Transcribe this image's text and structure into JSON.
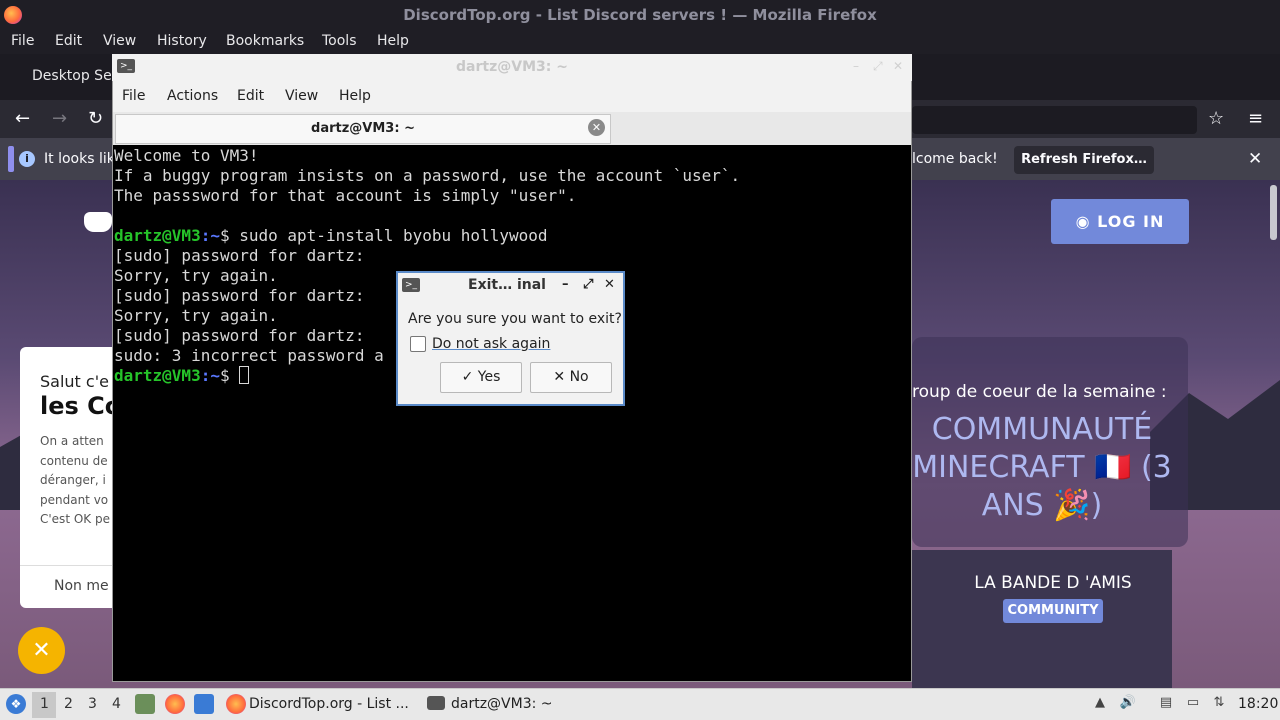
{
  "firefox": {
    "window_title": "DiscordTop.org - List Discord servers ! — Mozilla Firefox",
    "menu": [
      "File",
      "Edit",
      "View",
      "History",
      "Bookmarks",
      "Tools",
      "Help"
    ],
    "tab_label": "Desktop Ser",
    "notice_left": "It looks lik",
    "notice_right": "lcome back!",
    "refresh_label": "Refresh Firefox…",
    "close_glyph": "✕"
  },
  "page": {
    "login_label": "LOG IN",
    "cookie": {
      "greeting": "Salut c'e",
      "title": "les Co",
      "lines": [
        "On a atten",
        "contenu de",
        "déranger, i",
        "pendant vo",
        "C'est OK pe"
      ],
      "decline": "Non me"
    },
    "close_bubble": "✕",
    "feature": {
      "subtitle": "roup de coeur de la semaine :",
      "title_lines": [
        "COMMUNAUTÉ",
        "MINECRAFT 🇫🇷 (3",
        "ANS 🎉)"
      ]
    },
    "server": {
      "name": "LA BANDE D 'AMIS",
      "badge": "COMMUNITY"
    }
  },
  "terminal": {
    "window_title": "dartz@VM3: ~",
    "menu": [
      "File",
      "Actions",
      "Edit",
      "View",
      "Help"
    ],
    "tab_title": "dartz@VM3: ~",
    "lines": [
      "Welcome to VM3!",
      "If a buggy program insists on a password, use the account `user`.",
      "The passsword for that account is simply \"user\".",
      "",
      "",
      "[sudo] password for dartz:",
      "Sorry, try again.",
      "[sudo] password for dartz:",
      "Sorry, try again.",
      "[sudo] password for dartz:",
      "sudo: 3 incorrect password a"
    ],
    "prompt_user": "dartz@VM3",
    "prompt_path": ":~",
    "prompt_symbol": "$",
    "command": " sudo apt-install byobu hollywood"
  },
  "dialog": {
    "title": "Exit…  inal",
    "question": "Are you sure you want to exit?",
    "checkbox_label": "Do not ask again",
    "checkbox_checked": false,
    "yes_label": "✓ Yes",
    "no_label": "✕ No"
  },
  "taskbar": {
    "workspaces": [
      "1",
      "2",
      "3",
      "4"
    ],
    "active_workspace": "1",
    "task1_label": "DiscordTop.org - List ...",
    "task2_label": "dartz@VM3: ~",
    "clock": "18:20"
  },
  "colors": {
    "prompt_green": "#26c42a",
    "prompt_blue": "#5a78ff",
    "discord_blurple": "#7289da",
    "dialog_border": "#5a8ac8"
  }
}
